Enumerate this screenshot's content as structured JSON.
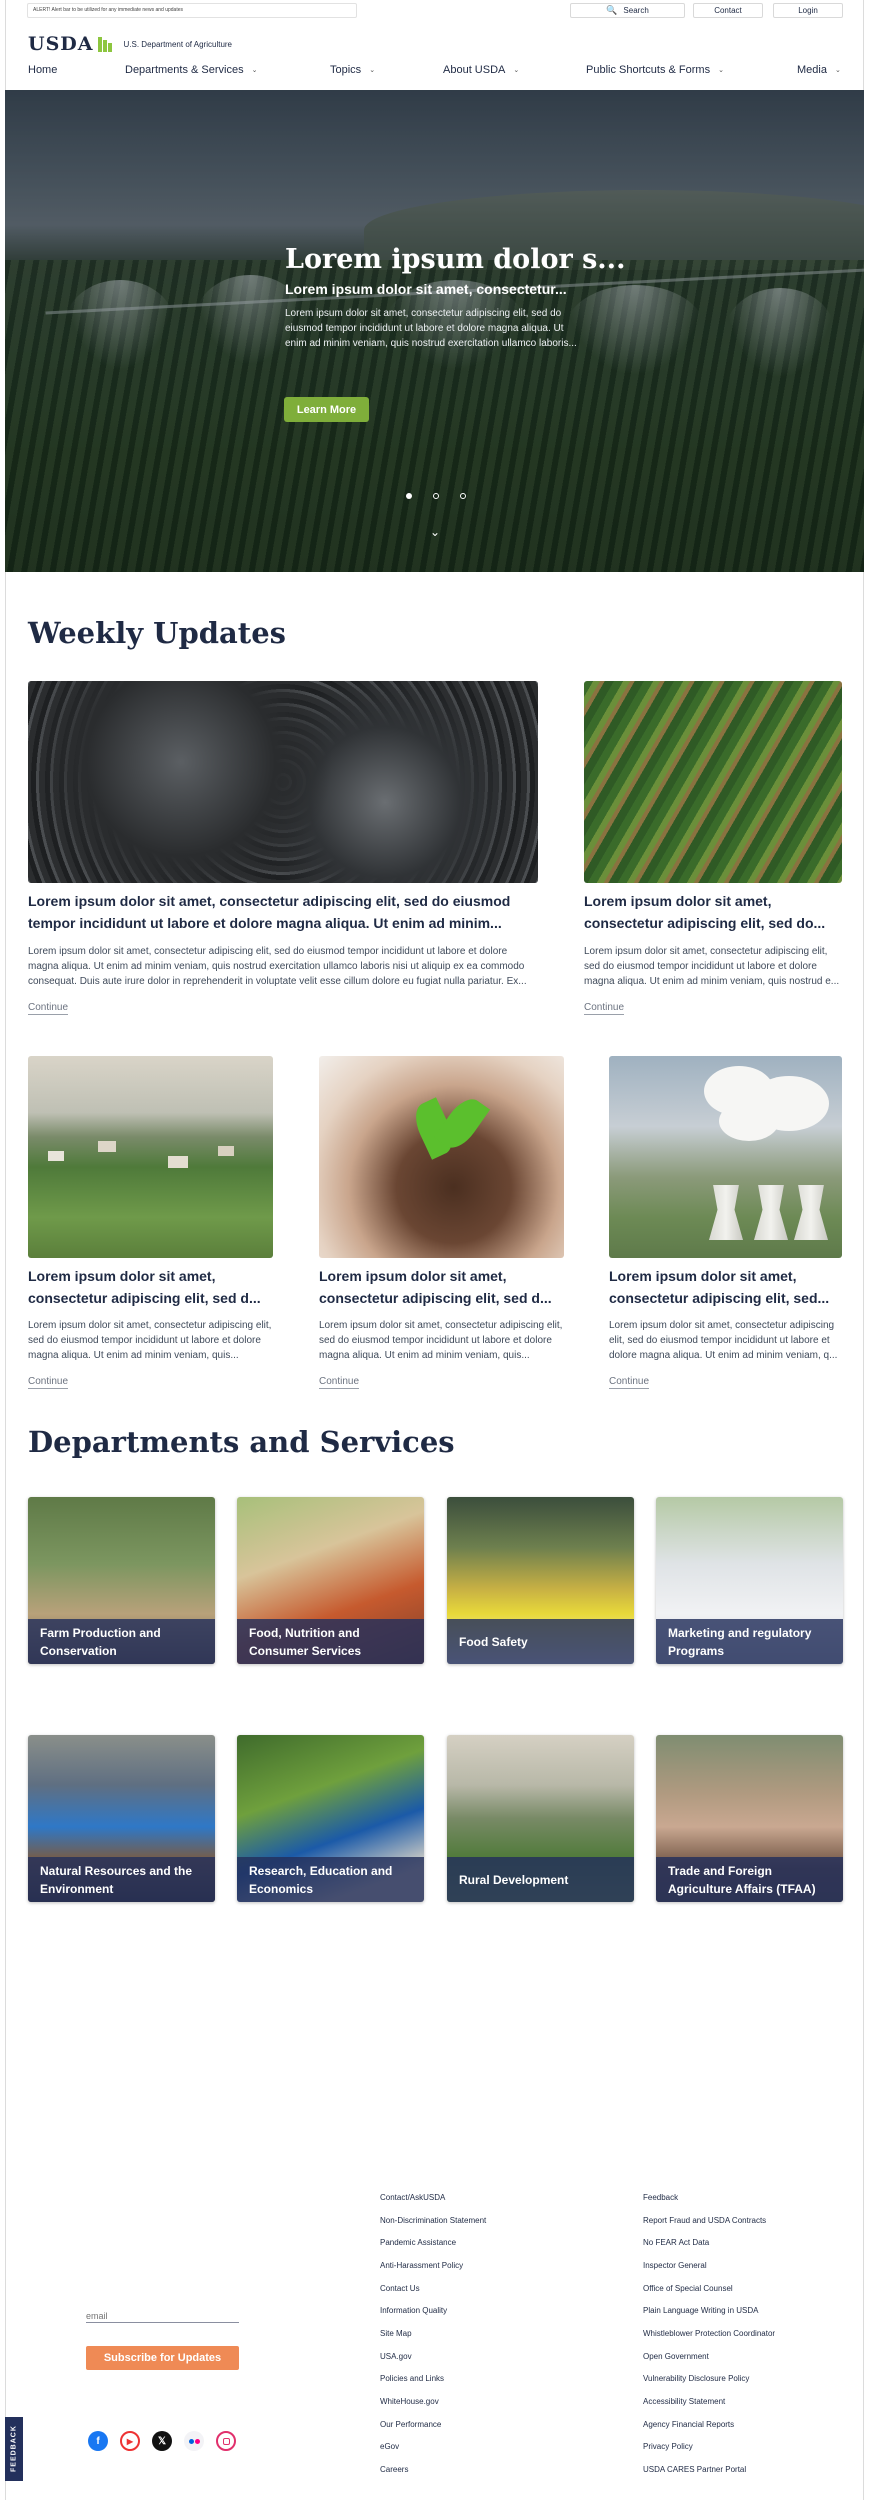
{
  "alert": "ALERT! Alert bar to be utilized for any immediate news and updates",
  "top_buttons": {
    "search": "Search",
    "contact": "Contact",
    "login": "Login"
  },
  "logo": {
    "name": "USDA",
    "subtitle": "U.S. Department of Agriculture"
  },
  "nav": [
    "Home",
    "Departments & Services",
    "Topics",
    "About USDA",
    "Public Shortcuts & Forms",
    "Media"
  ],
  "hero": {
    "title": "Lorem ipsum dolor s...",
    "subtitle": "Lorem ipsum dolor sit amet, consectetur...",
    "body": "Lorem ipsum dolor sit amet, consectetur adipiscing elit, sed do eiusmod tempor incididunt ut labore et dolore magna aliqua. Ut enim ad minim veniam, quis nostrud exercitation ullamco laboris...",
    "button": "Learn More",
    "active_slide": 1,
    "slide_count": 3
  },
  "weekly": {
    "heading": "Weekly Updates",
    "continue_label": "Continue",
    "cards": [
      {
        "title": "Lorem ipsum dolor sit amet, consectetur adipiscing elit, sed do eiusmod tempor incididunt ut labore et dolore magna aliqua. Ut enim ad minim...",
        "body": "Lorem ipsum dolor sit amet, consectetur adipiscing elit, sed do eiusmod tempor incididunt ut labore et dolore magna aliqua. Ut enim ad minim veniam, quis nostrud exercitation ullamco laboris nisi ut aliquip ex ea commodo consequat. Duis aute irure dolor in reprehenderit in voluptate velit esse cillum dolore eu fugiat nulla pariatur. Ex..."
      },
      {
        "title": "Lorem ipsum dolor sit amet, consectetur adipiscing elit, sed do...",
        "body": "Lorem ipsum dolor sit amet, consectetur adipiscing elit, sed do eiusmod tempor incididunt ut labore et dolore magna aliqua. Ut enim ad minim veniam, quis nostrud e..."
      },
      {
        "title": "Lorem ipsum dolor sit amet, consectetur adipiscing elit, sed d...",
        "body": "Lorem ipsum dolor sit amet, consectetur adipiscing elit, sed do eiusmod tempor incididunt ut labore et dolore magna aliqua. Ut enim ad minim veniam, quis..."
      },
      {
        "title": "Lorem ipsum dolor sit amet, consectetur adipiscing elit, sed d...",
        "body": "Lorem ipsum dolor sit amet, consectetur adipiscing elit, sed do eiusmod tempor incididunt ut labore et dolore magna aliqua. Ut enim ad minim veniam, quis..."
      },
      {
        "title": "Lorem ipsum dolor sit amet, consectetur adipiscing elit, sed...",
        "body": "Lorem ipsum dolor sit amet, consectetur adipiscing elit, sed do eiusmod tempor incididunt ut labore et dolore magna aliqua. Ut enim ad minim veniam, q..."
      }
    ]
  },
  "departments": {
    "heading": "Departments and Services",
    "items": [
      "Farm Production and Conservation",
      "Food, Nutrition and Consumer Services",
      "Food Safety",
      "Marketing and regulatory Programs",
      "Natural Resources and the Environment",
      "Research, Education and Economics",
      "Rural Development",
      "Trade and Foreign Agriculture Affairs (TFAA)"
    ]
  },
  "footer": {
    "email_placeholder": "email",
    "subscribe": "Subscribe for Updates",
    "col1": [
      "Contact/AskUSDA",
      "Non-Discrimination Statement",
      "Pandemic Assistance",
      "Anti-Harassment Policy",
      "Contact Us",
      "Information Quality",
      "Site Map",
      "USA.gov",
      "Policies and Links",
      "WhiteHouse.gov",
      "Our Performance",
      "eGov",
      "Careers"
    ],
    "col2": [
      "Feedback",
      "Report Fraud and USDA Contracts",
      "No FEAR Act Data",
      "Inspector General",
      "Office of Special Counsel",
      "Plain Language Writing in USDA",
      "Whistleblower Protection Coordinator",
      "Open Government",
      "Vulnerability Disclosure Policy",
      "Accessibility Statement",
      "Agency Financial Reports",
      "Privacy Policy",
      "USDA CARES Partner Portal"
    ],
    "social_icons": [
      "facebook-icon",
      "youtube-icon",
      "x-icon",
      "flickr-icon",
      "instagram-icon"
    ],
    "feedback_tab": "FEEDBACK"
  },
  "colors": {
    "navy": "#1f2a44",
    "green": "#7fae3a",
    "orange": "#ef8a55",
    "label_bg": "#23305c"
  }
}
